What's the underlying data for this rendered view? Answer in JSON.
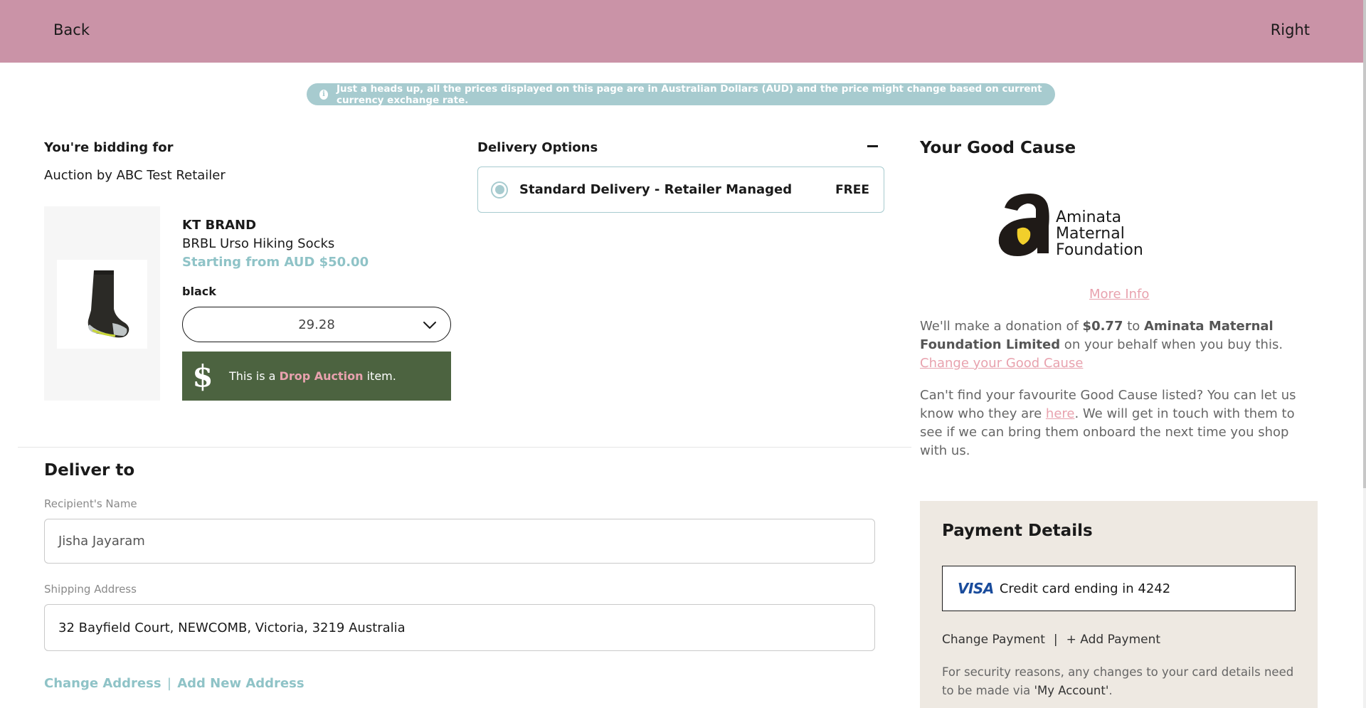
{
  "header": {
    "back_label": "Back",
    "right_label": "Right",
    "background_color": "#ca93a7"
  },
  "notice": {
    "icon": "info-icon",
    "text": "Just a heads up, all the prices displayed on this page are in Australian Dollars (AUD) and the price might change based on current currency exchange rate."
  },
  "bidding": {
    "title": "You're bidding for",
    "auction_by": "Auction by ABC Test Retailer",
    "product": {
      "brand": "KT BRAND",
      "name": "BRBL Urso Hiking Socks",
      "price": "Starting from AUD $50.00",
      "color": "black",
      "size_selected": "29.28"
    },
    "drop_banner": {
      "prefix": "This is a ",
      "highlight": "Drop Auction",
      "suffix": " item."
    }
  },
  "delivery": {
    "title": "Delivery Options",
    "option_label": "Standard Delivery - Retailer Managed",
    "option_price": "FREE"
  },
  "deliver_to": {
    "title": "Deliver to",
    "recipient_label": "Recipient's Name",
    "recipient_value": "Jisha Jayaram",
    "address_label": "Shipping Address",
    "address_value": "32 Bayfield Court, NEWCOMB, Victoria, 3219 Australia",
    "change_address": "Change Address",
    "separator": "|",
    "add_address": "Add New Address"
  },
  "good_cause": {
    "title": "Your Good Cause",
    "logo_name_line1": "Aminata",
    "logo_name_line2": "Maternal",
    "logo_name_line3": "Foundation",
    "more_info": "More Info",
    "donation_prefix": "We'll make a donation of ",
    "donation_amount": "$0.77",
    "donation_mid": " to ",
    "donation_org": "Aminata Maternal Foundation Limited",
    "donation_suffix": " on your behalf when you buy this.",
    "change_cause": "Change your Good Cause",
    "find_prefix": "Can't find your favourite Good Cause listed? You can let us know who they are ",
    "find_link": "here",
    "find_suffix": ". We will get in touch with them to see if we can bring them onboard the next time you shop with us."
  },
  "payment": {
    "title": "Payment Details",
    "card_brand": "VISA",
    "card_text": "Credit card ending in 4242",
    "change_payment": "Change Payment",
    "separator": "|",
    "add_payment": "+ Add Payment",
    "security_prefix": "For security reasons, any changes to your card details need to be made via ",
    "security_link": "'My Account'",
    "security_suffix": "."
  },
  "colors": {
    "accent_teal": "#a7cbcf",
    "accent_pink": "#e8a2ae",
    "drop_green": "#4c6340",
    "panel_beige": "#eee9e2"
  }
}
